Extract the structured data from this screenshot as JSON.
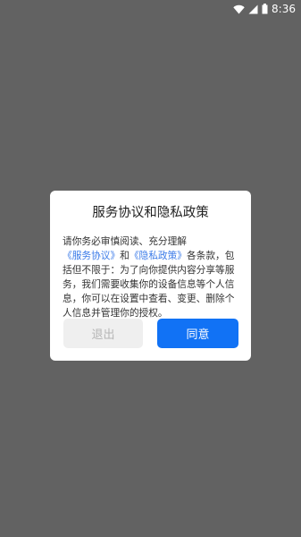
{
  "statusbar": {
    "time": "8:36"
  },
  "dialog": {
    "title": "服务协议和隐私政策",
    "body": {
      "part1": "请你务必审慎阅读、充分理解",
      "link1": "《服务协议》",
      "part2": "和",
      "link2": "《隐私政策》",
      "part3": "各条款，包括但不限于：为了向你提供内容分享等服务，我们需要收集你的设备信息等个人信息，你可以在设置中查看、变更、删除个人信息并管理你的授权。"
    },
    "exit_label": "退出",
    "agree_label": "同意"
  },
  "colors": {
    "overlay": "#626262",
    "link": "#3a7ae8",
    "primary_button": "#1172f5",
    "secondary_button": "#efefef"
  }
}
